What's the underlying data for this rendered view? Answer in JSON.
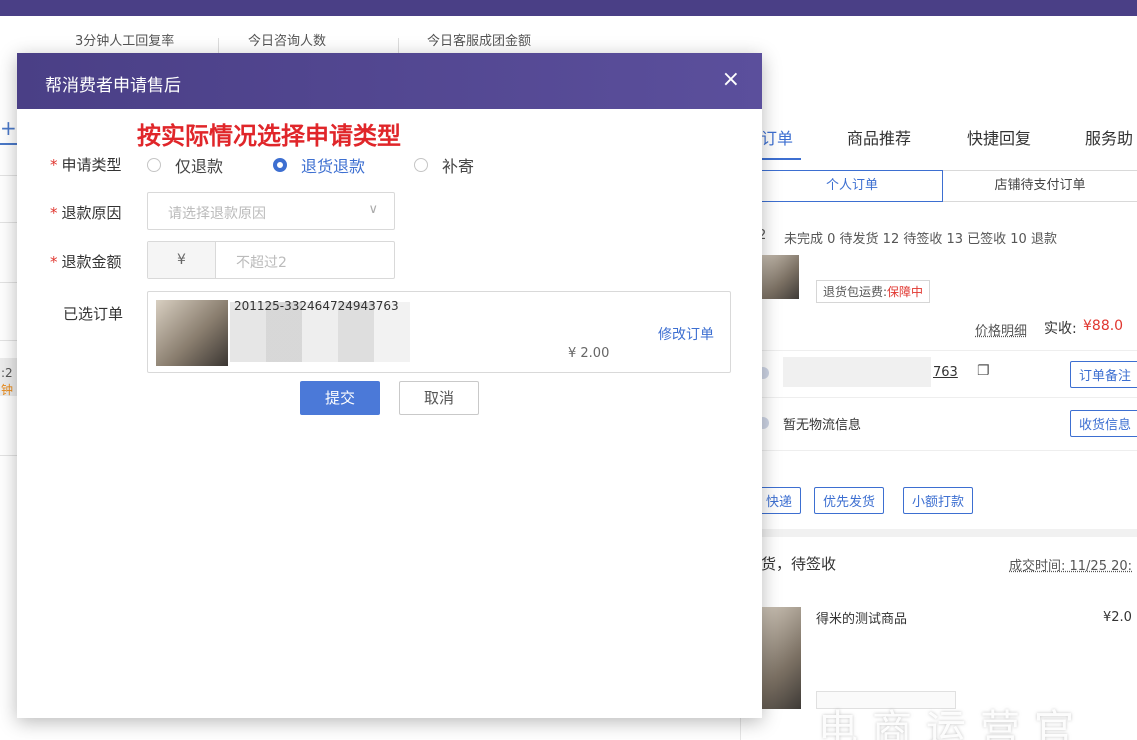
{
  "stats": [
    "3分钟人工回复率",
    "今日咨询人数",
    "今日客服成团金额"
  ],
  "modal": {
    "title": "帮消费者申请售后",
    "close": "×",
    "annotation": "按实际情况选择申请类型",
    "labels": {
      "type": "申请类型",
      "reason": "退款原因",
      "amount": "退款金额",
      "order": "已选订单"
    },
    "required_mark": "*",
    "type_options": [
      {
        "label": "仅退款",
        "checked": false
      },
      {
        "label": "退货退款",
        "checked": true
      },
      {
        "label": "补寄",
        "checked": false
      }
    ],
    "reason_placeholder": "请选择退款原因",
    "reason_chevron": "∨",
    "amount_prefix": "¥",
    "amount_placeholder": "不超过2",
    "order": {
      "id": "201125-332464724943763",
      "price": "¥ 2.00",
      "edit": "修改订单"
    },
    "submit": "提交",
    "cancel": "取消"
  },
  "right_panel": {
    "tabs": [
      {
        "label": "订单",
        "active": true
      },
      {
        "label": "商品推荐",
        "active": false
      },
      {
        "label": "快捷回复",
        "active": false
      },
      {
        "label": "服务助",
        "active": false
      }
    ],
    "segments": [
      {
        "label": "个人订单",
        "active": true
      },
      {
        "label": "店铺待支付订单",
        "active": false
      }
    ],
    "status_counts": "未完成 0  待发货 12  待签收 13  已签收 10  退款",
    "status_prefix": "2",
    "shipping_tag_label": "退货包运费:",
    "shipping_tag_status": "保障中",
    "price_detail": "价格明细",
    "actual_label": "实收:",
    "actual_value": "¥88.0",
    "order_no_tail": "763",
    "copy_icon": "❐",
    "order_note_btn": "订单备注",
    "logistics": "暂无物流信息",
    "receipt_btn": "收货信息",
    "actions": [
      "快递",
      "优先发货",
      "小额打款"
    ],
    "status_title": "货，待签收",
    "deal_time": "成交时间: 11/25 20:",
    "product_name": "得米的测试商品",
    "product_price": "¥2.0"
  },
  "left_sliver": {
    "plus": "+",
    "t1": ":2",
    "t2": "钟"
  },
  "watermark": "电商运营官"
}
